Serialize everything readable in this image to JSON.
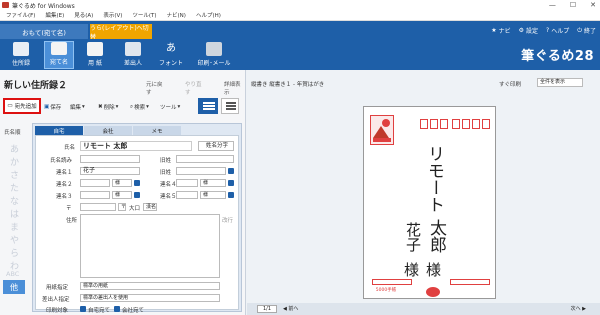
{
  "window": {
    "title": "筆ぐるめ for Windows",
    "controls": [
      "—",
      "☐",
      "✕"
    ]
  },
  "menu": [
    "ファイル(F)",
    "編集(E)",
    "見る(A)",
    "表示(V)",
    "ツール(T)",
    "ナビ(N)",
    "ヘルプ(H)"
  ],
  "mode_tabs": {
    "front": "おもて(宛て名)",
    "back": "うら(レイアウト)へ切替"
  },
  "top_right": {
    "navi": "ナビ",
    "settings": "設定",
    "help": "ヘルプ",
    "exit": "終了"
  },
  "ribbon": [
    {
      "label": "住所録"
    },
    {
      "label": "宛て名"
    },
    {
      "label": "用 紙"
    },
    {
      "label": "差出人"
    },
    {
      "label": "フォント"
    },
    {
      "label": "印刷･メール"
    }
  ],
  "brand": "筆ぐるめ28",
  "left": {
    "title": "新しい住所録２",
    "header_buttons": [
      "元に戻す",
      "やり直す",
      "詳細表示"
    ],
    "add_button": "宛先追加",
    "tools": [
      "保存",
      "編集",
      "削除",
      "検索",
      "ツール"
    ],
    "sidebar_label": "氏名順",
    "kana": [
      "あ",
      "か",
      "さ",
      "た",
      "な",
      "は",
      "ま",
      "や",
      "ら",
      "わ",
      "ABC"
    ],
    "kana_active": "他",
    "form": {
      "tabs": [
        "自宅",
        "会社",
        "メモ"
      ],
      "name_label": "氏名",
      "name_value": "リモート 太郎",
      "name_button": "姓名分字",
      "reading_label": "氏名読み",
      "rengi_labels": [
        "連名１",
        "連名２",
        "連名３",
        "連名４",
        "連名５"
      ],
      "rengi1_value": "花子",
      "title_label": "旧姓",
      "honorific": "様",
      "postal_label": "〒",
      "postal_buttons": [
        "〒",
        "大口",
        "漢名"
      ],
      "address_label": "住所",
      "address_button": "改行",
      "type_label": "用紙指定",
      "type_value": "標準の用紙",
      "sender_label": "差出人指定",
      "sender_value": "標準の差出人を使用",
      "print_label": "印刷対象",
      "print_options": [
        "自宅宛て",
        "会社宛て"
      ]
    }
  },
  "right": {
    "header": "縦書き 縦書き１ - 年賀はがき",
    "print_label": "すぐ印刷",
    "print_select": "全件を表示",
    "card": {
      "recipient_name_line": "リモート",
      "recipient_last": "太郎",
      "recipient_first": "花子",
      "honorific": "様",
      "stamp_text": "5000手帳"
    },
    "page": "1/1",
    "prev": "◀ 前へ",
    "next": "次へ ▶"
  }
}
